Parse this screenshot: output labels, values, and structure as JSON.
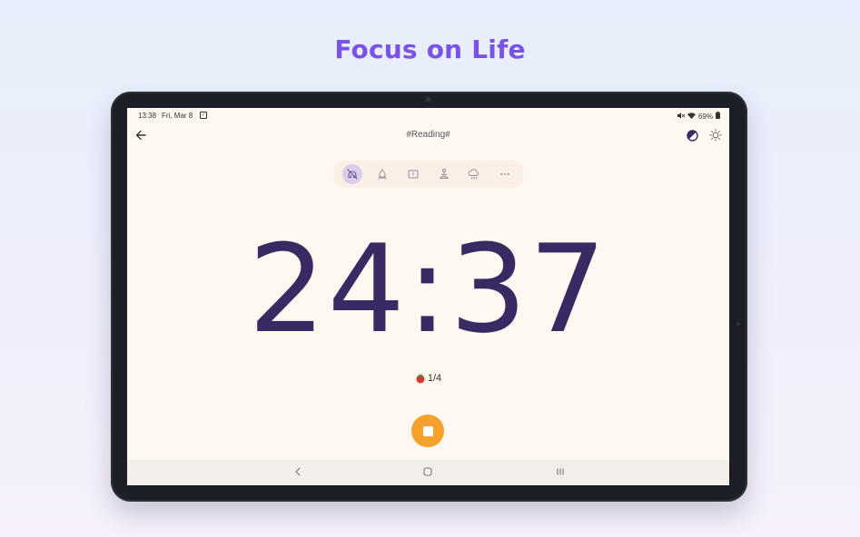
{
  "headline": "Focus on Life",
  "status_bar": {
    "time": "13:38",
    "date": "Fri, Mar 8",
    "battery": "69%"
  },
  "app_bar": {
    "tag": "#Reading#"
  },
  "ambient_sounds": [
    {
      "icon": "no-sound-icon",
      "active": true
    },
    {
      "icon": "campfire-icon",
      "active": false
    },
    {
      "icon": "book-icon",
      "active": false
    },
    {
      "icon": "meditation-icon",
      "active": false
    },
    {
      "icon": "rain-cloud-icon",
      "active": false
    },
    {
      "icon": "more-icon",
      "active": false
    }
  ],
  "timer": {
    "display": "24:37"
  },
  "session": {
    "count": "1/4",
    "icon": "tomato-icon"
  },
  "colors": {
    "headline": "#7b52e8",
    "timer": "#3a2a63",
    "stop_button": "#f5a12a",
    "screen_bg": "#fff8f1",
    "active_sound": "#dccdf0"
  }
}
